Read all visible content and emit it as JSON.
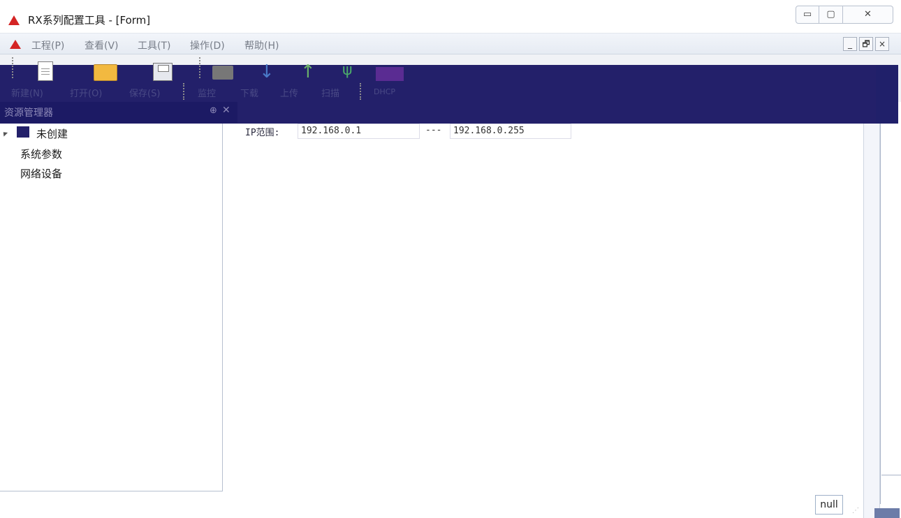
{
  "window": {
    "title": "RX系列配置工具 - [Form]",
    "controls": {
      "minimize": "▭",
      "maximize": "▢",
      "close": "✕"
    }
  },
  "menu": {
    "items": [
      {
        "label": "工程(P)"
      },
      {
        "label": "查看(V)"
      },
      {
        "label": "工具(T)"
      },
      {
        "label": "操作(D)"
      },
      {
        "label": "帮助(H)"
      }
    ],
    "mdi_controls": {
      "minimize": "_",
      "restore": "🗗",
      "close": "×"
    }
  },
  "toolbar": {
    "new_label": "新建(N)",
    "open_label": "打开(O)",
    "save_label": "保存(S)",
    "monitor_label": "监控",
    "download_label": "下载",
    "upload_label": "上传",
    "scan_label": "扫描",
    "dhcp_label": "DHCP",
    "icons": [
      "new-document-icon",
      "open-folder-icon",
      "save-floppy-icon",
      "monitor-icon",
      "download-arrow-icon",
      "upload-arrow-icon",
      "scan-usb-icon",
      "dhcp-icon"
    ]
  },
  "resource_panel": {
    "title": "资源管理器",
    "pin_glyph": "⊕",
    "close_glyph": "✕"
  },
  "tree": {
    "root": "未创建",
    "children": [
      "系统参数",
      "网络设备"
    ]
  },
  "form": {
    "ip_range_label": "IP范围:",
    "ip_start": "192.168.0.1",
    "separator": "---",
    "ip_end": "192.168.0.255"
  },
  "status": {
    "value": "null"
  },
  "colors": {
    "brand_red": "#d42424",
    "toolbar_dark": "#23206a",
    "panel_header": "#1c1a64"
  }
}
